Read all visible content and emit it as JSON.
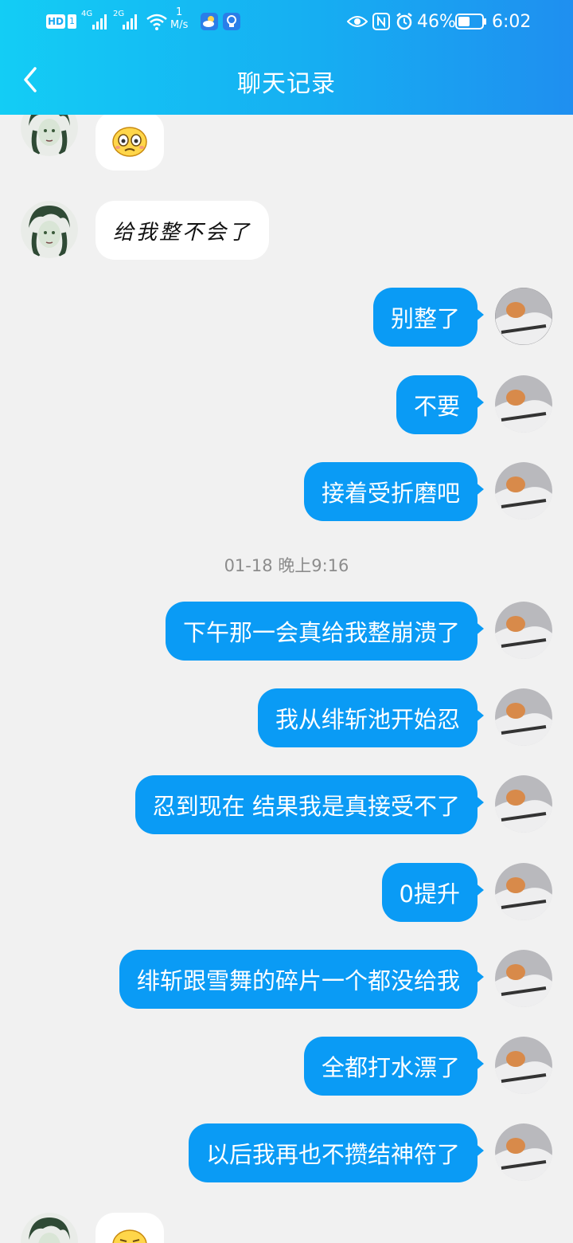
{
  "status_bar": {
    "hd": "HD",
    "network_4g": "4G",
    "network_2g": "2G",
    "speed_value": "1",
    "speed_unit": "M/s",
    "battery": "46%",
    "time": "6:02"
  },
  "header": {
    "title": "聊天记录"
  },
  "timestamp": "01-18 晚上9:16",
  "messages_top_other": [
    {
      "type": "emoji",
      "emoji_name": "embarrassed-emoji-icon"
    },
    {
      "type": "text",
      "text": "给我整不会了"
    }
  ],
  "messages_me_before": [
    {
      "text": "别整了"
    },
    {
      "text": "不要"
    },
    {
      "text": "接着受折磨吧"
    }
  ],
  "messages_me_after": [
    {
      "text": "下午那一会真给我整崩溃了"
    },
    {
      "text": "我从绯斩池开始忍"
    },
    {
      "text": "忍到现在 结果我是真接受不了"
    },
    {
      "text": "0提升"
    },
    {
      "text": "绯斩跟雪舞的碎片一个都没给我"
    },
    {
      "text": "全都打水漂了"
    },
    {
      "text": "以后我再也不攒结神符了"
    }
  ],
  "message_bottom_other": {
    "type": "emoji",
    "emoji_name": "smirk-emoji-icon"
  },
  "colors": {
    "header_start": "#13cdf5",
    "header_end": "#1f8ff0",
    "my_bubble": "#0a9bf5",
    "background": "#f1f1f1"
  }
}
